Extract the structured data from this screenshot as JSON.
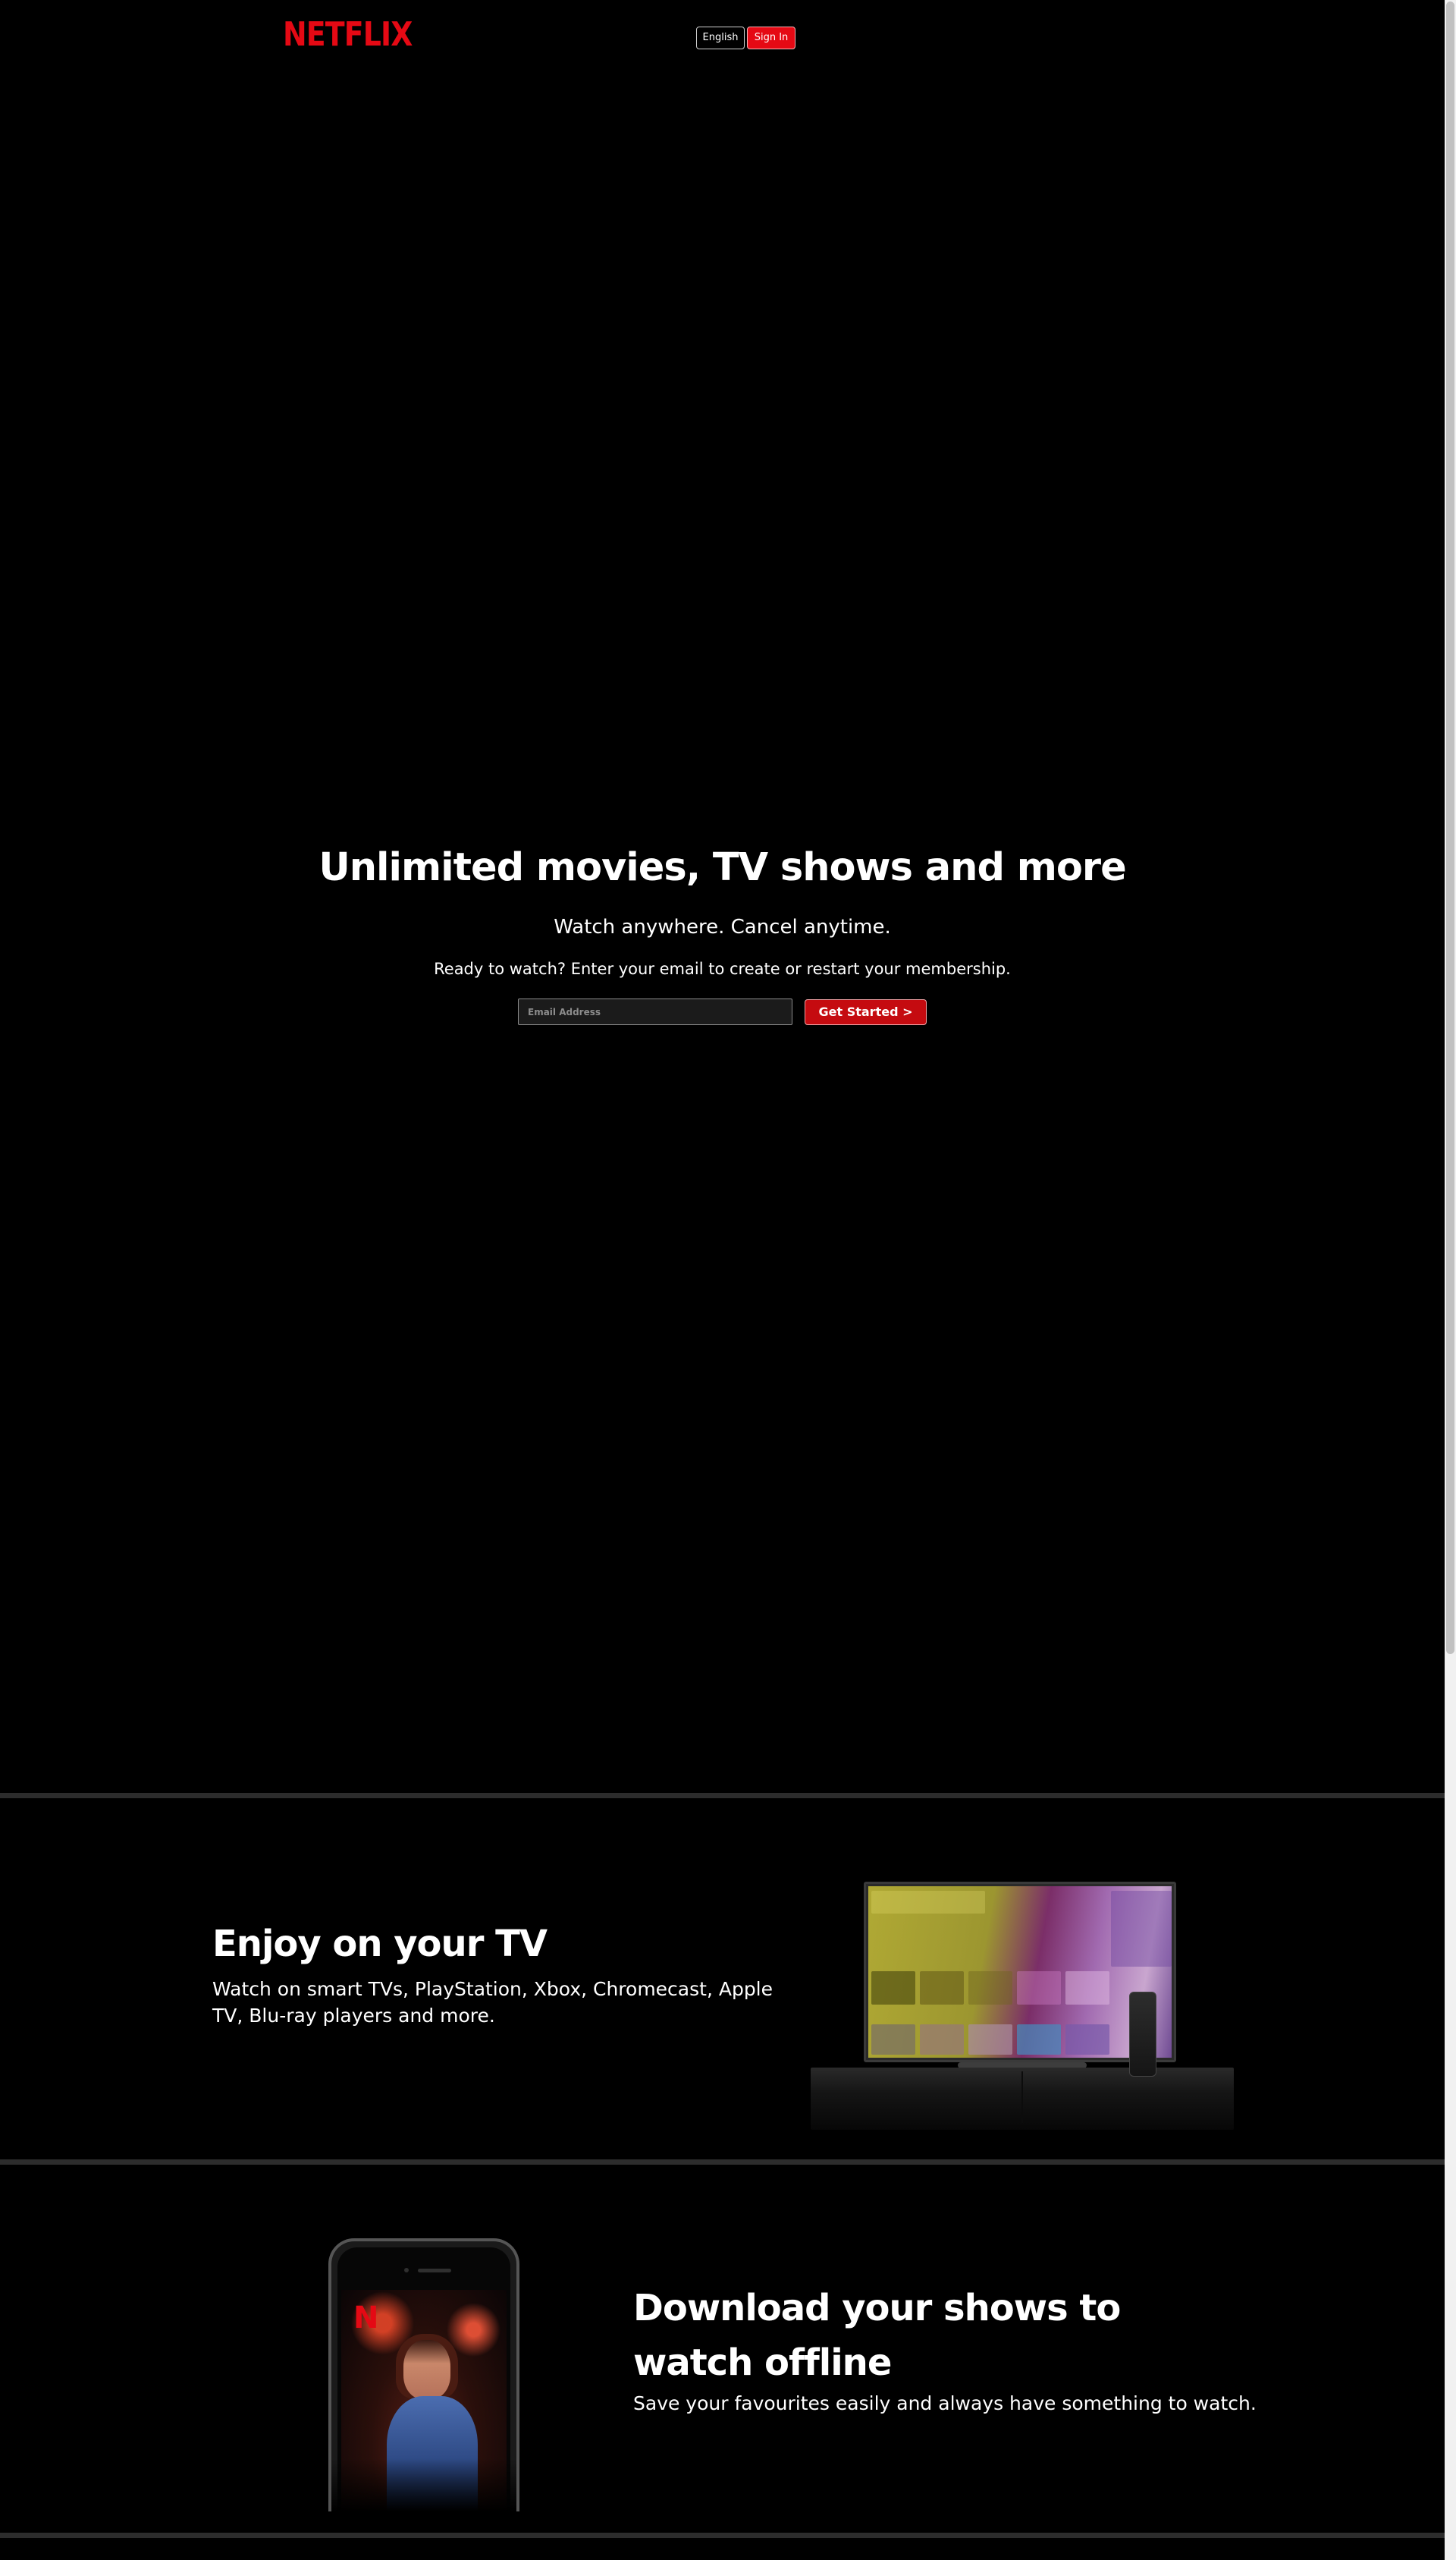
{
  "header": {
    "logo_text": "NETFLIX",
    "language_label": "English",
    "signin_label": "Sign In"
  },
  "hero": {
    "title": "Unlimited movies, TV shows and more",
    "subtitle": "Watch anywhere. Cancel anytime.",
    "cta_text": "Ready to watch? Enter your email to create or restart your membership.",
    "email_placeholder": "Email Address",
    "button_label": "Get Started >"
  },
  "features": [
    {
      "title": "Enjoy on your TV",
      "description": "Watch on smart TVs, PlayStation, Xbox, Chromecast, Apple TV, Blu-ray players and more."
    },
    {
      "title": "Download your shows to watch offline",
      "description": "Save your favourites easily and always have something to watch."
    }
  ],
  "colors": {
    "brand": "#e50914",
    "button": "#c50b10",
    "background": "#000000",
    "divider": "#2c2c2c"
  },
  "icons": {
    "logo": "netflix-wordmark",
    "phone_logo": "netflix-n"
  }
}
